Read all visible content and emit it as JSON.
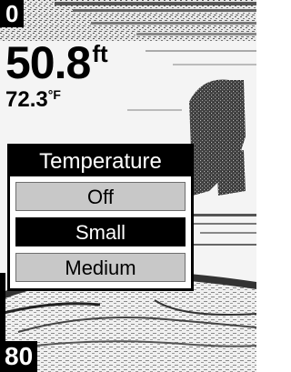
{
  "display": {
    "scale_top": "0",
    "scale_bottom": "80",
    "depth_value": "50.8",
    "depth_unit": "ft",
    "temp_value": "72.3",
    "temp_unit": "°F"
  },
  "menu": {
    "title": "Temperature",
    "options": [
      "Off",
      "Small",
      "Medium"
    ],
    "selected": "Small"
  },
  "colors": {
    "selection": "#000000",
    "option_bg": "#c8c8c8",
    "screen_bg": "#f4f4f4"
  }
}
